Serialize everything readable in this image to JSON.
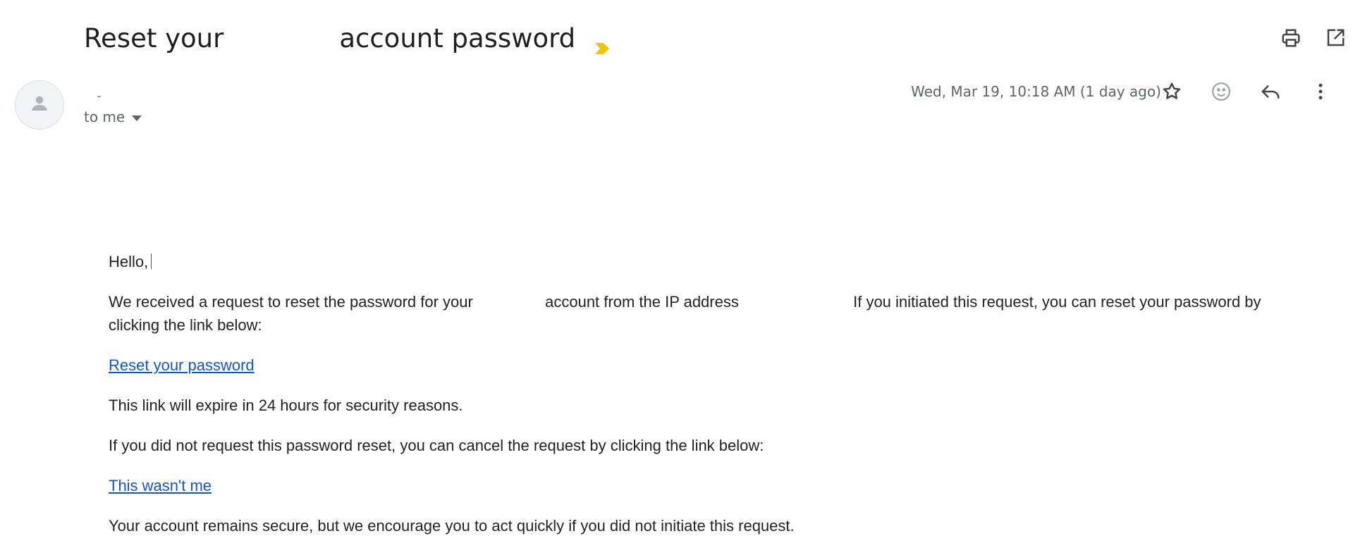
{
  "email": {
    "subject_part1": "Reset your",
    "subject_part2": "account password",
    "recipient_label": "to me",
    "date": "Wed, Mar 19, 10:18 AM (1 day ago)"
  },
  "toolbar_icons": {
    "print": "print-icon",
    "open_new_window": "open-in-new-window-icon",
    "star": "star-icon",
    "emoji": "emoji-reaction-icon",
    "reply": "reply-icon",
    "more": "more-vert-icon",
    "importance": "importance-marker-icon",
    "avatar": "person-icon"
  },
  "body": {
    "greeting": "Hello,",
    "request_part1": "We received a request to reset the password for your",
    "request_part2": "account from the IP address",
    "request_part3": "If you initiated this request, you can reset your password by clicking the link below:",
    "reset_link": "Reset your password",
    "expire_note": "This link will expire in 24 hours for security reasons.",
    "cancel_note": "If you did not request this password reset, you can cancel the request by clicking the link below:",
    "not_me_link": "This wasn't me",
    "secure_note": "Your account remains secure, but we encourage you to act quickly if you did not initiate this request."
  },
  "colors": {
    "link": "#1155cc",
    "importance_marker": "#f4c20d",
    "secondary_text": "#5f6368"
  }
}
